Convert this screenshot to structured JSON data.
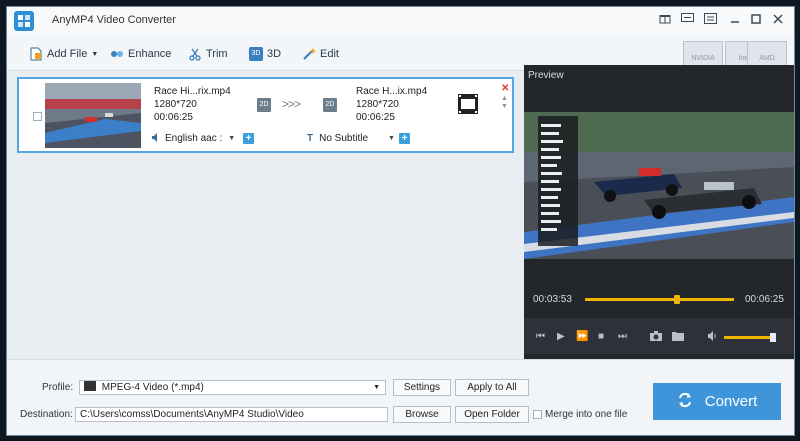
{
  "window": {
    "title": "AnyMP4 Video Converter",
    "controls": [
      "gift-icon",
      "chat-icon",
      "menu-icon",
      "minimize-icon",
      "maximize-icon",
      "close-icon"
    ]
  },
  "toolbar": {
    "add_file": "Add File",
    "enhance": "Enhance",
    "trim": "Trim",
    "three_d": "3D",
    "three_d_badge": "3D",
    "edit": "Edit",
    "hw_accel": [
      "NVIDIA",
      "Intel",
      "AMD"
    ]
  },
  "file": {
    "source_name": "Race Hi...rix.mp4",
    "source_resolution": "1280*720",
    "source_duration": "00:06:25",
    "source_mode": "2D",
    "arrows": ">>>",
    "target_name": "Race H...ix.mp4",
    "target_resolution": "1280*720",
    "target_duration": "00:06:25",
    "target_mode": "2D",
    "audio_track": "English aac :",
    "subtitle": "No Subtitle",
    "plus": "+"
  },
  "preview": {
    "label": "Preview",
    "current_time": "00:03:53",
    "total_time": "00:06:25",
    "progress": 0.62,
    "volume": 1.0
  },
  "bottom": {
    "profile_label": "Profile:",
    "profile_value": "MPEG-4 Video (*.mp4)",
    "settings": "Settings",
    "apply_all": "Apply to All",
    "destination_label": "Destination:",
    "destination_value": "C:\\Users\\comss\\Documents\\AnyMP4 Studio\\Video",
    "browse": "Browse",
    "open_folder": "Open Folder",
    "merge": "Merge into one file",
    "convert": "Convert"
  },
  "colors": {
    "accent": "#3e95d9",
    "selection_border": "#52a8e0",
    "seek": "#f0b400",
    "remove": "#e04030"
  }
}
